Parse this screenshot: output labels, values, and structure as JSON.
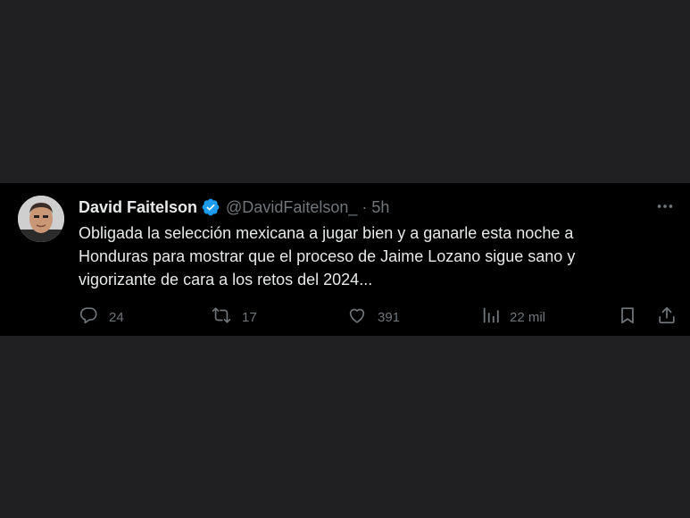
{
  "tweet": {
    "display_name": "David Faitelson",
    "handle": "@DavidFaitelson_",
    "separator": "·",
    "time": "5h",
    "text_lines": [
      "Obligada la selección mexicana a jugar bien y a ganarle esta noche a",
      "Honduras para mostrar que el proceso de Jaime Lozano sigue sano y",
      "vigorizante de cara a los retos del 2024..."
    ],
    "stats": {
      "replies": "24",
      "retweets": "17",
      "likes": "391",
      "views": "22 mil"
    }
  },
  "colors": {
    "background": "#202022",
    "card": "#000000",
    "text_primary": "#e7e9ea",
    "text_secondary": "#71767b",
    "verified": "#1d9bf0"
  },
  "icons": {
    "more": "more-dots-icon",
    "verified": "verified-badge-icon",
    "reply": "reply-bubble-icon",
    "retweet": "retweet-icon",
    "like": "heart-icon",
    "views": "views-chart-icon",
    "bookmark": "bookmark-icon",
    "share": "share-icon"
  }
}
